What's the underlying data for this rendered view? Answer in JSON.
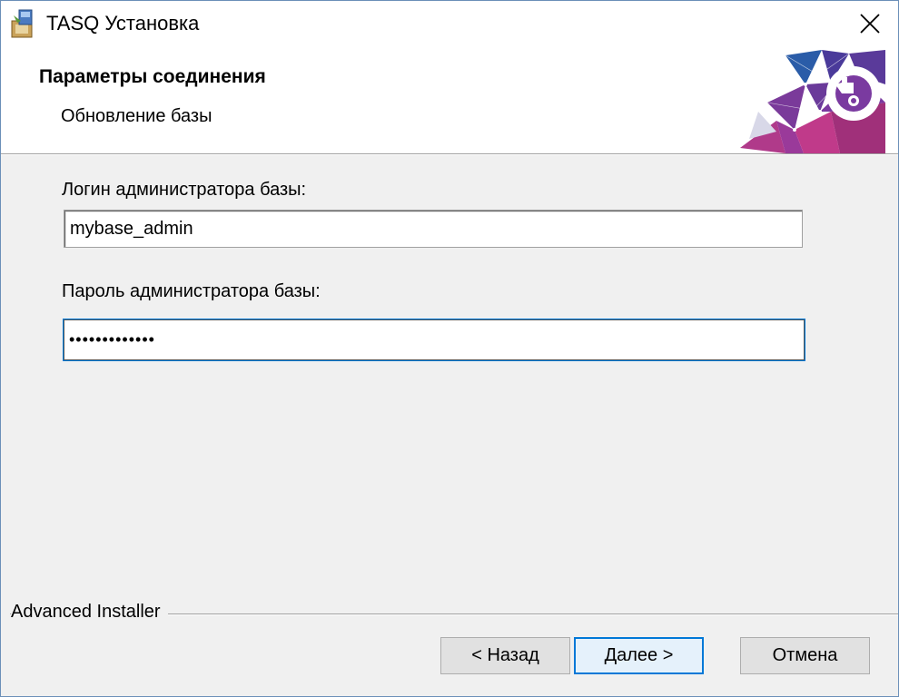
{
  "window": {
    "title": "TASQ Установка"
  },
  "header": {
    "title": "Параметры соединения",
    "subtitle": "Обновление базы"
  },
  "form": {
    "login_label": "Логин администратора базы:",
    "login_value": "mybase_admin",
    "password_label": "Пароль администратора базы:",
    "password_value": "•••••••••••••"
  },
  "footer": {
    "brand": "Advanced Installer",
    "back_label": "< Назад",
    "next_label": "Далее >",
    "cancel_label": "Отмена"
  },
  "icons": {
    "app": "installer-package-icon",
    "close": "close-icon",
    "banner": "puzzle-network-banner"
  },
  "colors": {
    "accent": "#0078d7",
    "banner_primary": "#5a3a9a",
    "banner_secondary": "#c03a8a",
    "banner_blue": "#2a5ca8"
  }
}
